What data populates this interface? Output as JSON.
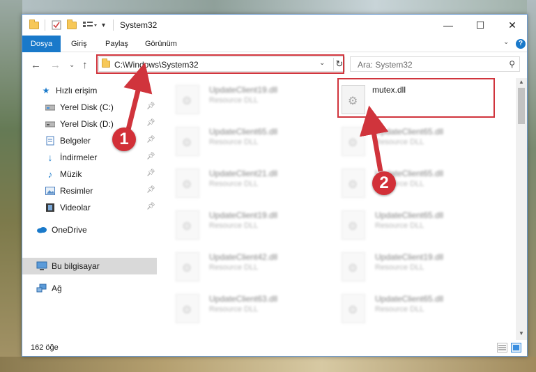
{
  "window": {
    "title": "System32",
    "controls": {
      "minimize": "—",
      "maximize": "☐",
      "close": "✕"
    }
  },
  "ribbon": {
    "tabs": [
      {
        "label": "Dosya"
      },
      {
        "label": "Giriş"
      },
      {
        "label": "Paylaş"
      },
      {
        "label": "Görünüm"
      }
    ],
    "help": "?"
  },
  "nav": {
    "address": "C:\\Windows\\System32",
    "search_placeholder": "Ara: System32"
  },
  "sidebar": {
    "items": [
      {
        "label": "Hızlı erişim",
        "icon": "star-icon",
        "pinned": false
      },
      {
        "label": "Yerel Disk (C:)",
        "icon": "drive-icon",
        "pinned": true
      },
      {
        "label": "Yerel Disk (D:)",
        "icon": "drive-icon",
        "pinned": true
      },
      {
        "label": "Belgeler",
        "icon": "documents-icon",
        "pinned": true
      },
      {
        "label": "İndirmeler",
        "icon": "download-icon",
        "pinned": true
      },
      {
        "label": "Müzik",
        "icon": "music-icon",
        "pinned": true
      },
      {
        "label": "Resimler",
        "icon": "pictures-icon",
        "pinned": true
      },
      {
        "label": "Videolar",
        "icon": "videos-icon",
        "pinned": true
      },
      {
        "label": "OneDrive",
        "icon": "cloud-icon",
        "pinned": false
      },
      {
        "label": "Bu bilgisayar",
        "icon": "computer-icon",
        "pinned": false,
        "selected": true
      },
      {
        "label": "Ağ",
        "icon": "network-icon",
        "pinned": false
      }
    ]
  },
  "files": {
    "left_column": [
      {
        "name": "UpdateClient19.dll",
        "type": "Resource DLL"
      },
      {
        "name": "UpdateClient65.dll",
        "type": "Resource DLL"
      },
      {
        "name": "UpdateClient21.dll",
        "type": "Resource DLL"
      },
      {
        "name": "UpdateClient19.dll",
        "type": "Resource DLL"
      },
      {
        "name": "UpdateClient42.dll",
        "type": "Resource DLL"
      },
      {
        "name": "UpdateClient63.dll",
        "type": "Resource DLL"
      }
    ],
    "right_column": [
      {
        "name": "mutex.dll",
        "type": ""
      },
      {
        "name": "UpdateClient65.dll",
        "type": "Resource DLL"
      },
      {
        "name": "UpdateClient65.dll",
        "type": "Resource DLL"
      },
      {
        "name": "UpdateClient65.dll",
        "type": "Resource DLL"
      },
      {
        "name": "UpdateClient19.dll",
        "type": "Resource DLL"
      },
      {
        "name": "UpdateClient65.dll",
        "type": "Resource DLL"
      }
    ]
  },
  "status": {
    "item_count": "162 öğe"
  },
  "annotations": {
    "step1": "1",
    "step2": "2",
    "color": "#d0343c"
  }
}
